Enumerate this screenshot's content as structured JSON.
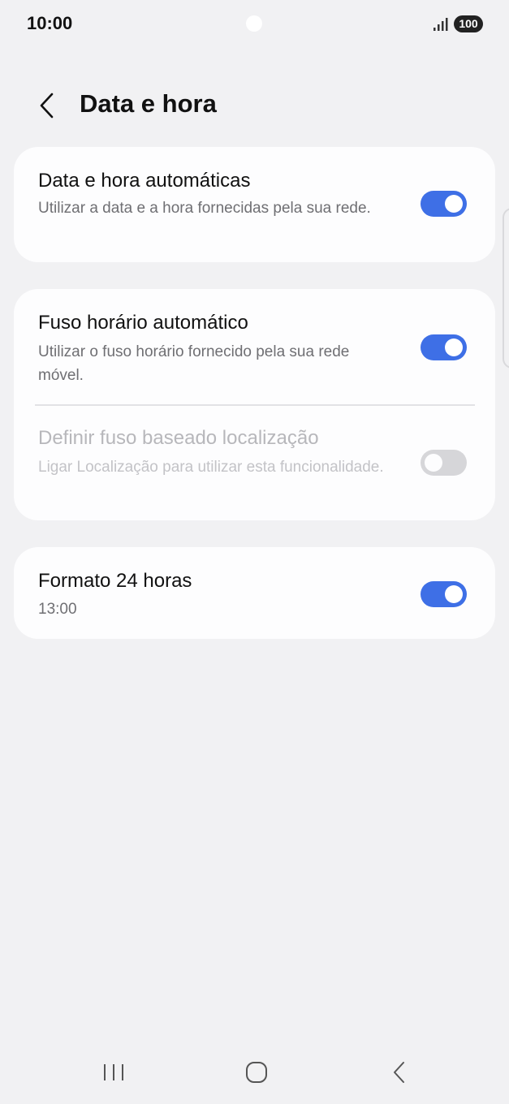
{
  "status_bar": {
    "time": "10:00",
    "battery": "100",
    "icons": [
      "signal-icon"
    ]
  },
  "header": {
    "title": "Data e hora",
    "back_icon": "chevron-left-icon"
  },
  "colors": {
    "background": "#f1f1f3",
    "card": "#fdfdfe",
    "toggle_on": "#3e6fe6",
    "toggle_off": "#d6d6d9"
  },
  "settings": {
    "auto_datetime": {
      "title": "Data e hora automáticas",
      "subtitle": "Utilizar a data e a hora fornecidas pela sua rede.",
      "enabled": true
    },
    "auto_timezone": {
      "title": "Fuso horário automático",
      "subtitle": "Utilizar o fuso horário fornecido pela sua rede móvel.",
      "enabled": true
    },
    "location_timezone": {
      "title": "Definir fuso baseado localização",
      "subtitle": "Ligar Localização para utilizar esta funcionalidade.",
      "enabled": false,
      "disabled": true
    },
    "format_24h": {
      "title": "Formato 24 horas",
      "subtitle": "13:00",
      "enabled": true
    }
  },
  "nav_bar": {
    "icons": [
      "recent-apps-icon",
      "home-icon",
      "back-icon"
    ]
  }
}
